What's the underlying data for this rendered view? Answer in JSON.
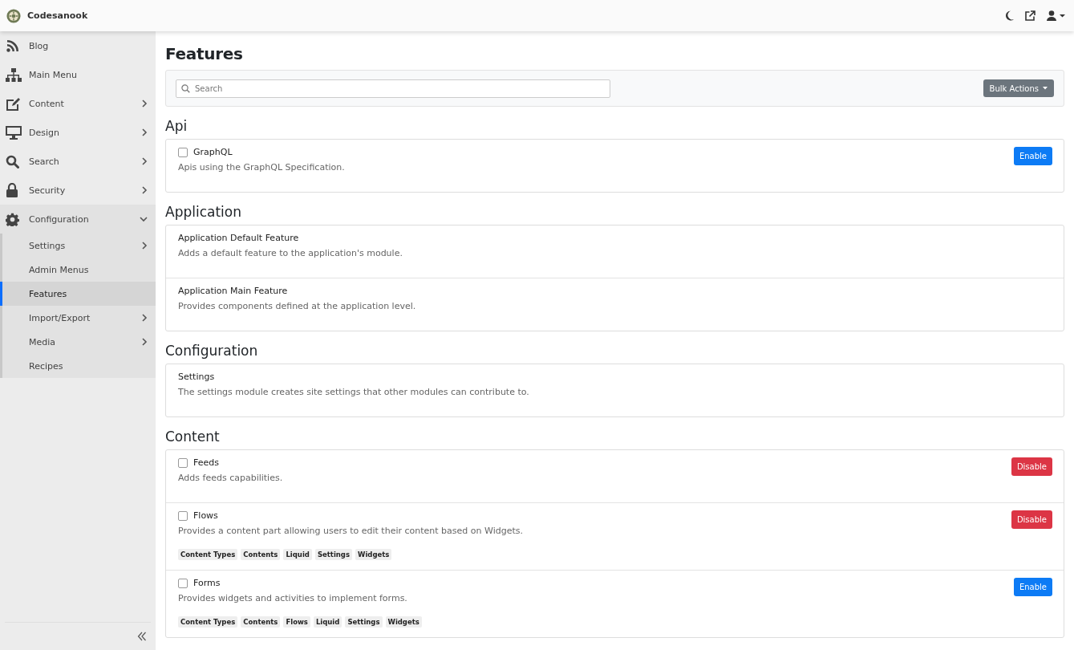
{
  "brand": {
    "name": "Codesanook"
  },
  "topbar_icons": [
    {
      "kind": "moon"
    },
    {
      "kind": "external"
    },
    {
      "kind": "user"
    }
  ],
  "sidebar": {
    "items": [
      {
        "label": "Blog"
      },
      {
        "label": "Main Menu"
      },
      {
        "label": "Content",
        "expanded": false
      },
      {
        "label": "Design",
        "expanded": false
      },
      {
        "label": "Search",
        "expanded": false
      },
      {
        "label": "Security",
        "expanded": false
      },
      {
        "label": "Configuration",
        "expanded": true,
        "children": [
          {
            "label": "Settings",
            "selected": false,
            "expanded": false
          },
          {
            "label": "Admin Menus",
            "selected": false
          },
          {
            "label": "Features",
            "selected": true
          },
          {
            "label": "Import/Export",
            "selected": false,
            "expanded": false
          },
          {
            "label": "Media",
            "selected": false,
            "expanded": false
          },
          {
            "label": "Recipes",
            "selected": false
          }
        ]
      }
    ]
  },
  "page": {
    "title": "Features",
    "search": {
      "placeholder": "Search"
    },
    "bulk_actions": {
      "label": "Bulk Actions"
    }
  },
  "sections": [
    {
      "title": "Api",
      "features": [
        {
          "name": "GraphQL",
          "description": "Apis using the GraphQL Specification.",
          "checked": false,
          "action": {
            "kind": "enable",
            "label": "Enable"
          }
        }
      ]
    },
    {
      "title": "Application",
      "features": [
        {
          "name": "Application Default Feature",
          "description": "Adds a default feature to the application's module."
        },
        {
          "name": "Application Main Feature",
          "description": "Provides components defined at the application level."
        }
      ]
    },
    {
      "title": "Configuration",
      "features": [
        {
          "name": "Settings",
          "description": "The settings module creates site settings that other modules can contribute to."
        }
      ]
    },
    {
      "title": "Content",
      "features": [
        {
          "name": "Feeds",
          "description": "Adds feeds capabilities.",
          "checked": false,
          "action": {
            "kind": "disable",
            "label": "Disable"
          }
        },
        {
          "name": "Flows",
          "description": "Provides a content part allowing users to edit their content based on Widgets.",
          "checked": false,
          "action": {
            "kind": "disable",
            "label": "Disable"
          },
          "tags": [
            "Content Types",
            "Contents",
            "Liquid",
            "Settings",
            "Widgets"
          ]
        },
        {
          "name": "Forms",
          "description": "Provides widgets and activities to implement forms.",
          "checked": false,
          "action": {
            "kind": "enable",
            "label": "Enable"
          },
          "tags": [
            "Content Types",
            "Contents",
            "Flows",
            "Liquid",
            "Settings",
            "Widgets"
          ]
        }
      ]
    }
  ]
}
